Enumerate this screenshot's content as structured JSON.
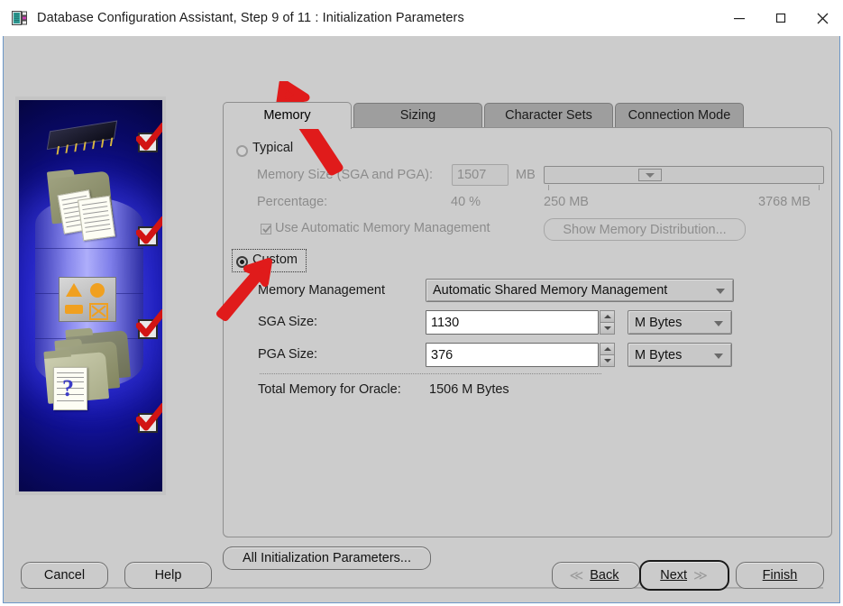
{
  "window": {
    "title": "Database Configuration Assistant, Step 9 of 11 : Initialization Parameters",
    "icon": "database-config-icon",
    "minimize_label": "–",
    "maximize_label": "☐",
    "close_label": "✕"
  },
  "tabs": [
    {
      "label": "Memory",
      "active": true
    },
    {
      "label": "Sizing",
      "active": false
    },
    {
      "label": "Character Sets",
      "active": false
    },
    {
      "label": "Connection Mode",
      "active": false
    }
  ],
  "memory_tab": {
    "typical": {
      "radio_label": "Typical",
      "selected": false,
      "memory_size_label": "Memory Size (SGA and PGA):",
      "memory_size_value": "1507",
      "memory_size_unit": "MB",
      "percentage_label": "Percentage:",
      "percentage_value": "40 %",
      "slider_min_label": "250 MB",
      "slider_max_label": "3768 MB",
      "auto_mem_checkbox_label": "Use Automatic Memory Management",
      "auto_mem_checked": true,
      "show_distribution_button": "Show Memory Distribution..."
    },
    "custom": {
      "radio_label": "Custom",
      "selected": true,
      "memory_management_label": "Memory Management",
      "memory_management_value": "Automatic Shared Memory Management",
      "sga_label": "SGA Size:",
      "sga_value": "1130",
      "sga_unit": "M Bytes",
      "pga_label": "PGA Size:",
      "pga_value": "376",
      "pga_unit": "M Bytes",
      "total_label": "Total Memory for Oracle:",
      "total_value": "1506 M Bytes"
    }
  },
  "all_params_button": "All Initialization Parameters...",
  "footer": {
    "cancel": "Cancel",
    "help": "Help",
    "back": "Back",
    "back_arrow": "≪",
    "next": "Next",
    "next_arrow": "≫",
    "finish": "Finish"
  },
  "colors": {
    "panel_bg": "#cccccc",
    "tab_inactive": "#9e9e9e",
    "annotation_arrow": "#e01b1b",
    "art_blue": "#1717b5",
    "accent_orange": "#f0a020"
  }
}
